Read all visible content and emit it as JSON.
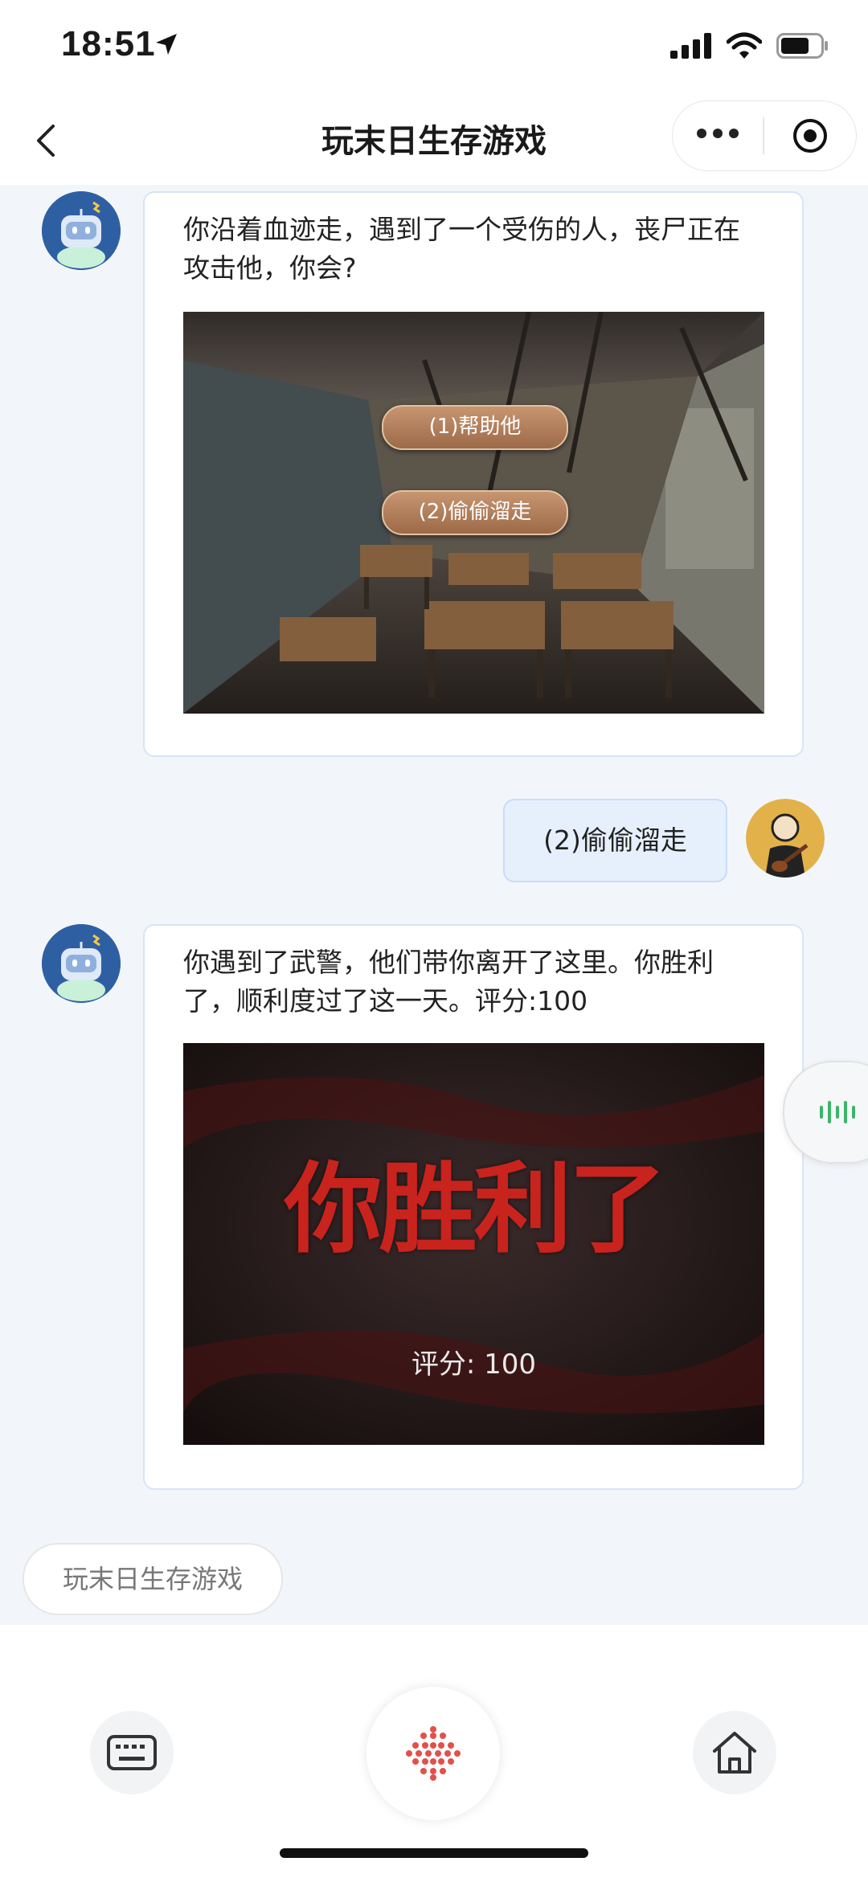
{
  "status": {
    "time": "18:51"
  },
  "nav": {
    "title": "玩末日生存游戏"
  },
  "messages": {
    "bot1": {
      "text": "你沿着血迹走，遇到了一个受伤的人，丧尸正在攻击他，你会?",
      "options": [
        "(1)帮助他",
        "(2)偷偷溜走"
      ]
    },
    "user1": {
      "text": "(2)偷偷溜走"
    },
    "bot2": {
      "text": "你遇到了武警，他们带你离开了这里。你胜利了，顺利度过了这一天。评分:100",
      "banner_title": "你胜利了",
      "banner_score": "评分: 100"
    }
  },
  "suggestion_chip": "玩末日生存游戏",
  "icons": {
    "back": "chevron-left-icon",
    "more": "more-dots-icon",
    "close": "target-icon",
    "voice": "voice-wave-icon",
    "keyboard": "keyboard-icon",
    "mic": "mic-dots-icon",
    "home": "home-icon"
  },
  "colors": {
    "accent_red": "#e2504a",
    "voice_green": "#3bb56a",
    "user_bubble": "#e6f0fd"
  }
}
